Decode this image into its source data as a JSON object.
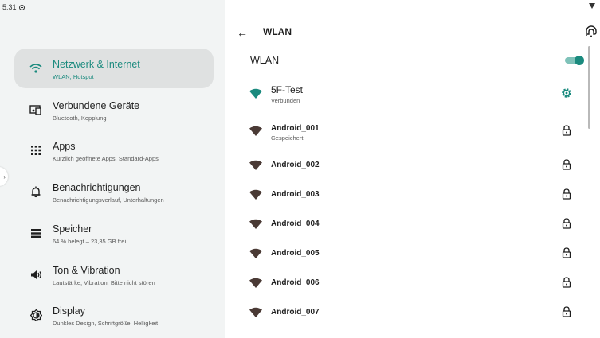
{
  "status_bar": {
    "time": "5:31"
  },
  "sidebar": {
    "items": [
      {
        "title": "Netzwerk & Internet",
        "subtitle": "WLAN, Hotspot",
        "icon": "wifi-icon",
        "selected": true
      },
      {
        "title": "Verbundene Geräte",
        "subtitle": "Bluetooth, Kopplung",
        "icon": "connected-devices-icon",
        "selected": false
      },
      {
        "title": "Apps",
        "subtitle": "Kürzlich geöffnete Apps, Standard-Apps",
        "icon": "apps-grid-icon",
        "selected": false
      },
      {
        "title": "Benachrichtigungen",
        "subtitle": "Benachrichtigungsverlauf, Unterhaltungen",
        "icon": "bell-icon",
        "selected": false
      },
      {
        "title": "Speicher",
        "subtitle": "64 % belegt – 23,35 GB frei",
        "icon": "storage-icon",
        "selected": false
      },
      {
        "title": "Ton & Vibration",
        "subtitle": "Lautstärke, Vibration, Bitte nicht stören",
        "icon": "volume-icon",
        "selected": false
      },
      {
        "title": "Display",
        "subtitle": "Dunkles Design, Schriftgröße, Helligkeit",
        "icon": "brightness-icon",
        "selected": false
      }
    ]
  },
  "header": {
    "title": "WLAN"
  },
  "wlan": {
    "label": "WLAN",
    "enabled": true
  },
  "networks": [
    {
      "name": "5F-Test",
      "status": "Verbunden",
      "connected": true,
      "icon": "gear-icon"
    },
    {
      "name": "Android_001",
      "status": "Gespeichert",
      "connected": false,
      "icon": "lock-icon"
    },
    {
      "name": "Android_002",
      "status": "",
      "connected": false,
      "icon": "lock-icon"
    },
    {
      "name": "Android_003",
      "status": "",
      "connected": false,
      "icon": "lock-icon"
    },
    {
      "name": "Android_004",
      "status": "",
      "connected": false,
      "icon": "lock-icon"
    },
    {
      "name": "Android_005",
      "status": "",
      "connected": false,
      "icon": "lock-icon"
    },
    {
      "name": "Android_006",
      "status": "",
      "connected": false,
      "icon": "lock-icon"
    },
    {
      "name": "Android_007",
      "status": "",
      "connected": false,
      "icon": "lock-icon"
    }
  ],
  "colors": {
    "accent": "#1a8a7e",
    "wifi_idle": "#4a3a35",
    "sidebar_bg": "#f2f4f4",
    "selected_bg": "#dfe1e1"
  }
}
